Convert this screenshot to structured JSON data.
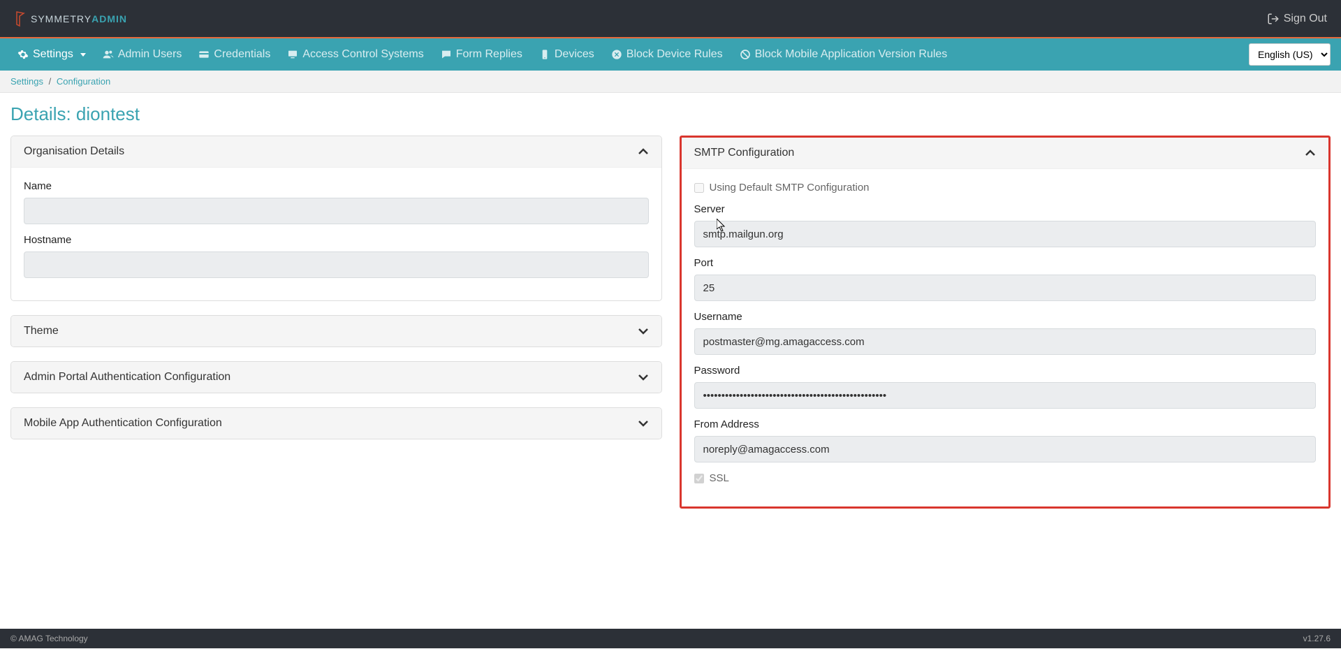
{
  "header": {
    "logo_text1": "SYMMETRY",
    "logo_text2": "ADMIN",
    "signout_label": "Sign Out"
  },
  "nav": {
    "settings": "Settings",
    "admin_users": "Admin Users",
    "credentials": "Credentials",
    "access_control": "Access Control Systems",
    "form_replies": "Form Replies",
    "devices": "Devices",
    "block_device_rules": "Block Device Rules",
    "block_mobile_rules": "Block Mobile Application Version Rules",
    "lang_selected": "English (US)"
  },
  "breadcrumb": {
    "root": "Settings",
    "current": "Configuration"
  },
  "page": {
    "title": "Details: diontest"
  },
  "panels": {
    "org": {
      "title": "Organisation Details",
      "name_label": "Name",
      "name_value": "",
      "hostname_label": "Hostname",
      "hostname_value": ""
    },
    "theme": {
      "title": "Theme"
    },
    "admin_auth": {
      "title": "Admin Portal Authentication Configuration"
    },
    "mobile_auth": {
      "title": "Mobile App Authentication Configuration"
    },
    "smtp": {
      "title": "SMTP Configuration",
      "use_default_label": "Using Default SMTP Configuration",
      "use_default_checked": false,
      "server_label": "Server",
      "server_value": "smtp.mailgun.org",
      "port_label": "Port",
      "port_value": "25",
      "username_label": "Username",
      "username_value": "postmaster@mg.amagaccess.com",
      "password_label": "Password",
      "password_value": "••••••••••••••••••••••••••••••••••••••••••••••••••",
      "from_label": "From Address",
      "from_value": "noreply@amagaccess.com",
      "ssl_label": "SSL",
      "ssl_checked": true
    }
  },
  "footer": {
    "copyright": "© AMAG Technology",
    "version": "v1.27.6"
  }
}
